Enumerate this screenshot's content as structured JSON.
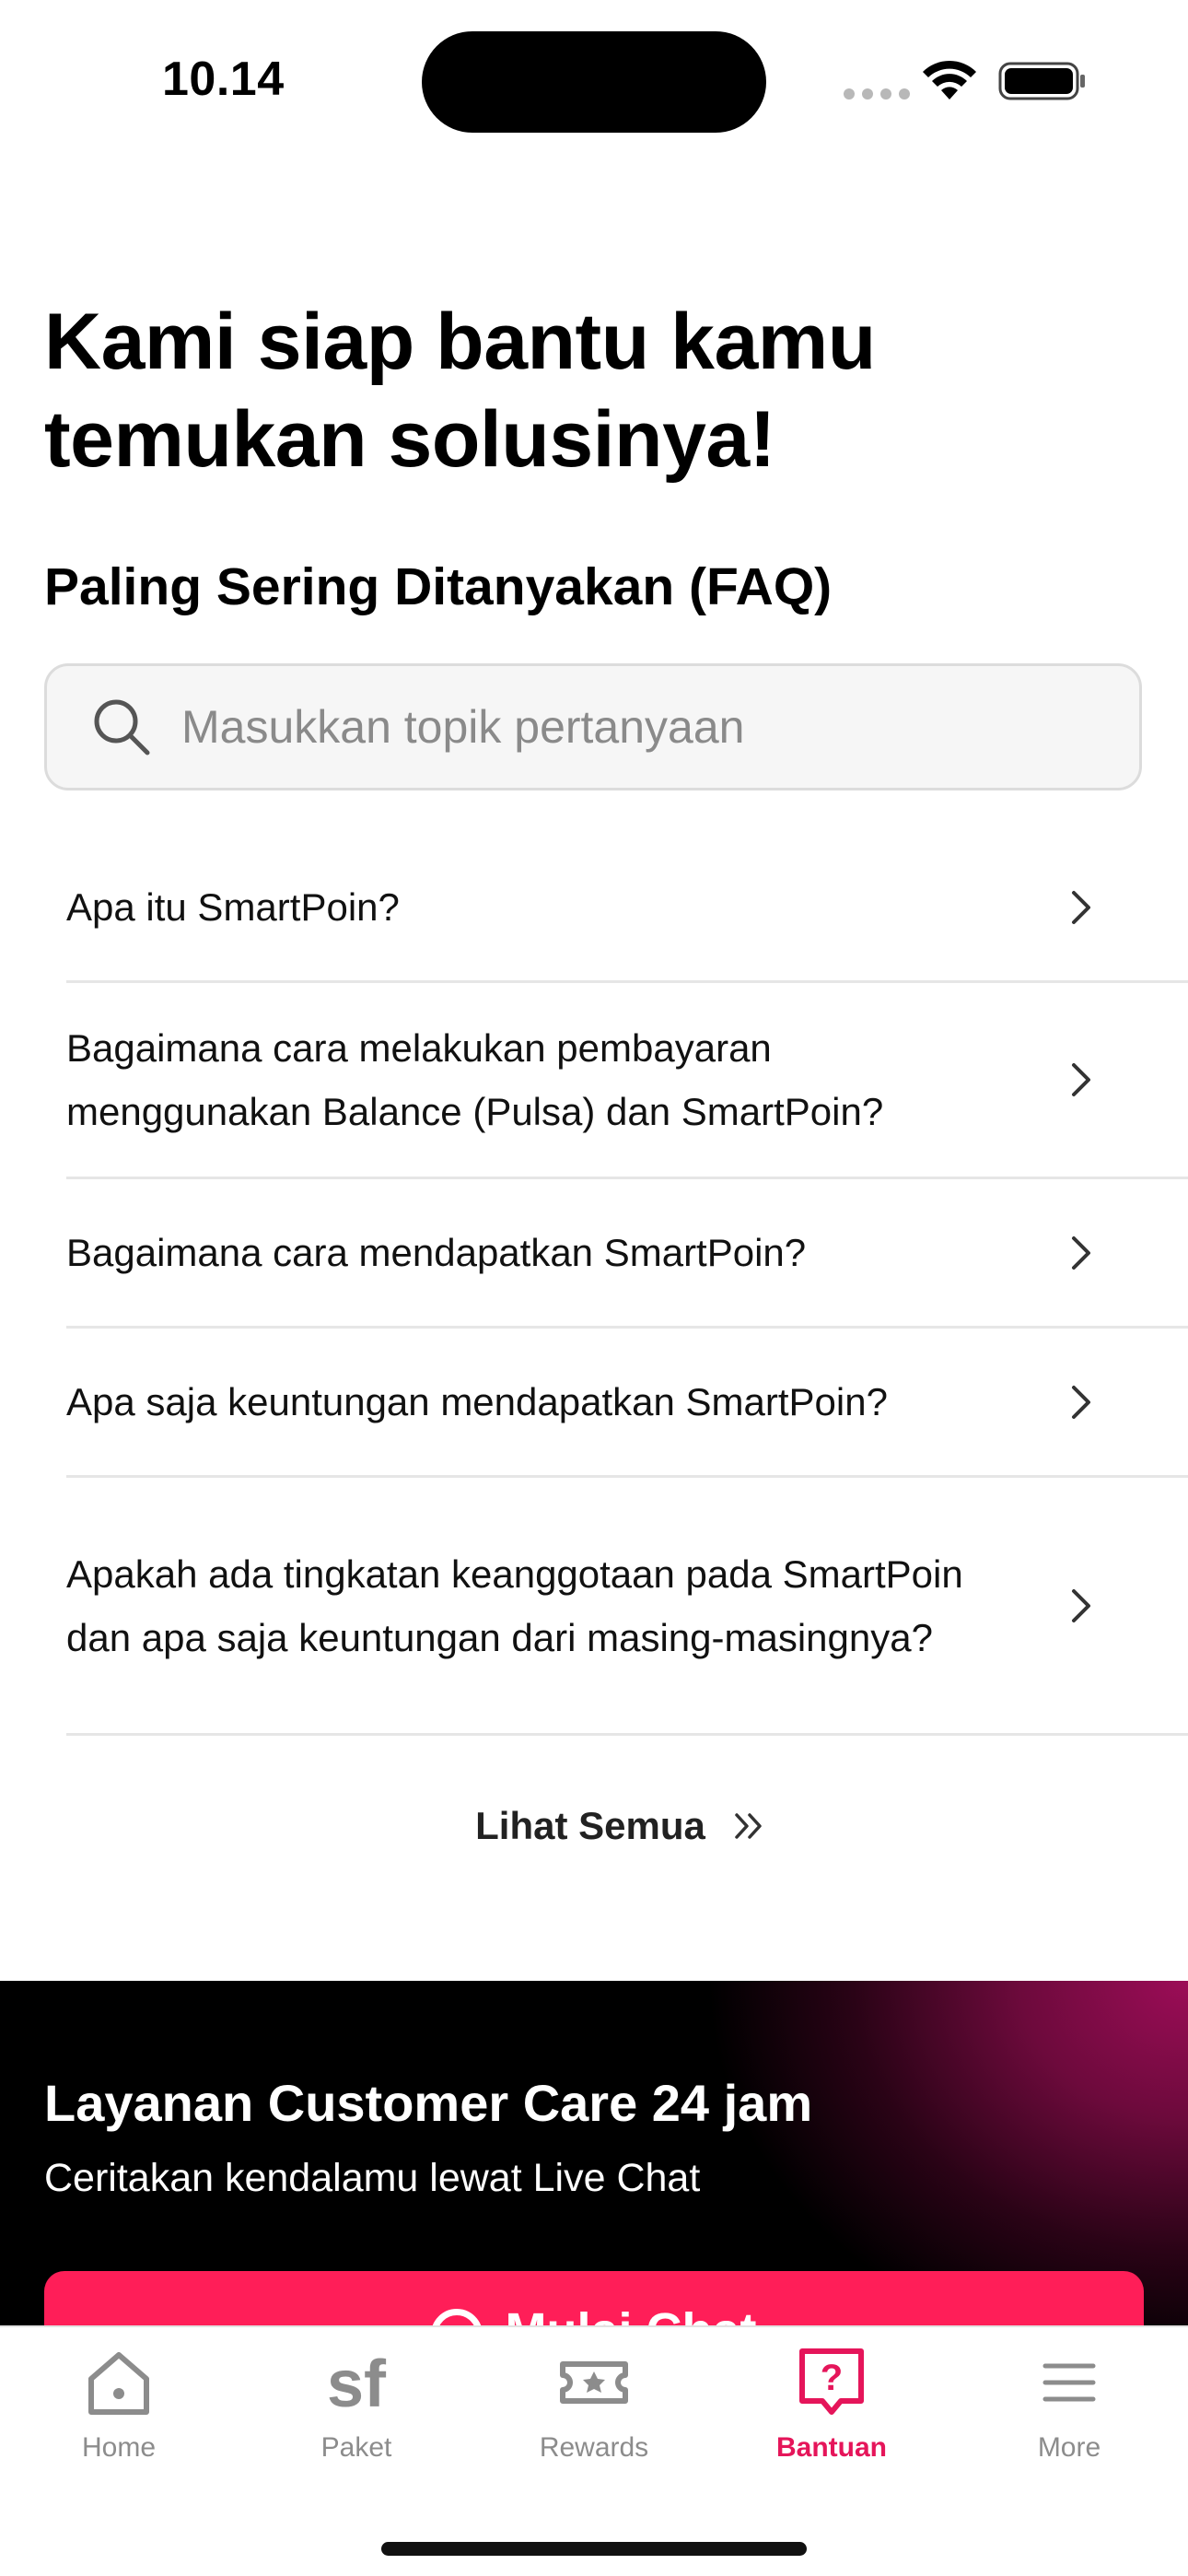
{
  "status_bar": {
    "time": "10.14"
  },
  "hero": {
    "title": "Kami siap bantu kamu temukan solusinya!"
  },
  "faq": {
    "section_title": "Paling Sering Ditanyakan (FAQ)",
    "search_placeholder": "Masukkan topik pertanyaan",
    "items": [
      {
        "question": "Apa itu SmartPoin?"
      },
      {
        "question": "Bagaimana cara melakukan pembayaran menggunakan Balance (Pulsa) dan SmartPoin?"
      },
      {
        "question": "Bagaimana cara mendapatkan SmartPoin?"
      },
      {
        "question": "Apa saja keuntungan mendapatkan SmartPoin?"
      },
      {
        "question": "Apakah ada tingkatan keanggotaan pada SmartPoin dan apa saja keuntungan dari masing-masingnya?"
      }
    ],
    "see_all_label": "Lihat Semua"
  },
  "care": {
    "title": "Layanan Customer Care 24 jam",
    "subtitle": "Ceritakan kendalamu lewat Live Chat",
    "button_label": "Mulai Chat"
  },
  "tab_bar": {
    "items": [
      {
        "label": "Home",
        "icon": "home-icon"
      },
      {
        "label": "Paket",
        "icon": "sf-logo-icon"
      },
      {
        "label": "Rewards",
        "icon": "ticket-icon"
      },
      {
        "label": "Bantuan",
        "icon": "help-icon",
        "active": true
      },
      {
        "label": "More",
        "icon": "menu-icon"
      }
    ]
  },
  "colors": {
    "accent": "#ff1e58",
    "tab_active": "#e5155a",
    "tab_inactive": "#8c8c8c"
  }
}
